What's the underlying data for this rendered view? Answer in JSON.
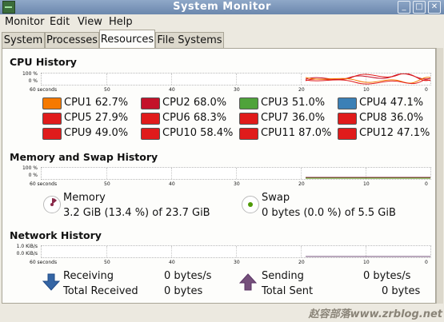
{
  "window": {
    "title": "System Monitor"
  },
  "menu": [
    {
      "label": "Monitor"
    },
    {
      "label": "Edit"
    },
    {
      "label": "View"
    },
    {
      "label": "Help"
    }
  ],
  "tabs": [
    {
      "label": "System"
    },
    {
      "label": "Processes"
    },
    {
      "label": "Resources",
      "active": true
    },
    {
      "label": "File Systems"
    }
  ],
  "cpu_history": {
    "title": "CPU History",
    "y_labels": [
      "100 %",
      "0 %"
    ],
    "x_labels": [
      "60 seconds",
      "50",
      "40",
      "30",
      "20",
      "10",
      "0"
    ],
    "cpus": [
      {
        "label": "CPU1 62.7%",
        "color": "#f57900"
      },
      {
        "label": "CPU2 68.0%",
        "color": "#c4122a"
      },
      {
        "label": "CPU3 51.0%",
        "color": "#4fa33a"
      },
      {
        "label": "CPU4 47.1%",
        "color": "#3b80b6"
      },
      {
        "label": "CPU5 27.9%",
        "color": "#e01b1b"
      },
      {
        "label": "CPU6 68.3%",
        "color": "#e01b1b"
      },
      {
        "label": "CPU7 36.0%",
        "color": "#e01b1b"
      },
      {
        "label": "CPU8 36.0%",
        "color": "#e01b1b"
      },
      {
        "label": "CPU9 49.0%",
        "color": "#e01b1b"
      },
      {
        "label": "CPU10 58.4%",
        "color": "#e01b1b"
      },
      {
        "label": "CPU11 87.0%",
        "color": "#e01b1b"
      },
      {
        "label": "CPU12 47.1%",
        "color": "#e01b1b"
      }
    ]
  },
  "memory_history": {
    "title": "Memory and Swap History",
    "y_labels": [
      "100 %",
      "0 %"
    ],
    "x_labels": [
      "60 seconds",
      "50",
      "40",
      "30",
      "20",
      "10",
      "0"
    ],
    "memory": {
      "label": "Memory",
      "value": "3.2 GiB (13.4 %) of 23.7 GiB"
    },
    "swap": {
      "label": "Swap",
      "value": "0 bytes (0.0 %) of 5.5 GiB"
    }
  },
  "network_history": {
    "title": "Network History",
    "y_labels": [
      "1.0 KiB/s",
      "0.0 KiB/s"
    ],
    "x_labels": [
      "60 seconds",
      "50",
      "40",
      "30",
      "20",
      "10",
      "0"
    ],
    "receiving": {
      "label": "Receiving",
      "value": "0 bytes/s"
    },
    "total_received": {
      "label": "Total Received",
      "value": "0 bytes"
    },
    "sending": {
      "label": "Sending",
      "value": "0 bytes/s"
    },
    "total_sent": {
      "label": "Total Sent",
      "value": "0 bytes"
    }
  },
  "watermark": "赵容部落www.zrblog.net",
  "colors": {
    "memory": "#8a2a4a",
    "swap": "#4e9a06",
    "receive": "#3465a4",
    "send": "#75507b"
  }
}
